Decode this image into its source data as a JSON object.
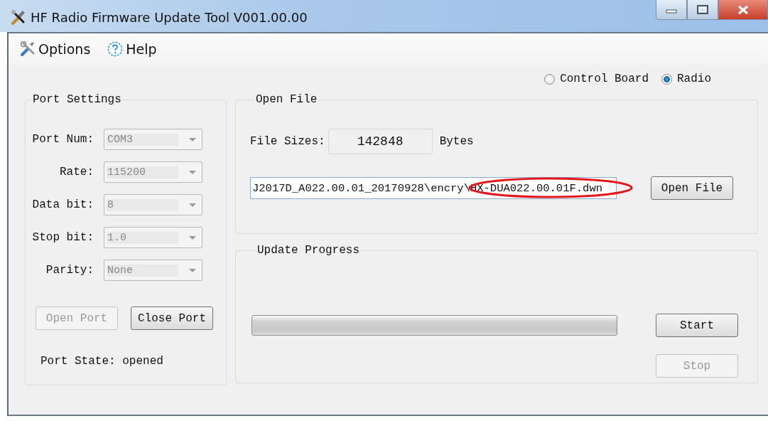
{
  "window": {
    "title": "HF Radio Firmware Update Tool V001.00.00"
  },
  "menu": [
    {
      "label": "Options",
      "kind": "tools"
    },
    {
      "label": "Help",
      "kind": "help"
    }
  ],
  "target": [
    {
      "label": "Control Board",
      "selected": false
    },
    {
      "label": "Radio",
      "selected": true
    }
  ],
  "port_settings": {
    "title": "Port Settings",
    "fields": [
      {
        "label": "Port Num:",
        "value": "COM3",
        "disabled": true
      },
      {
        "label": "Rate:",
        "value": "115200",
        "disabled": true
      },
      {
        "label": "Data bit:",
        "value": "8",
        "disabled": true
      },
      {
        "label": "Stop bit:",
        "value": "1.0",
        "disabled": true
      },
      {
        "label": "Parity:",
        "value": "None",
        "disabled": true
      }
    ],
    "buttons": [
      {
        "label": "Open Port",
        "disabled": true
      },
      {
        "label": "Close Port",
        "disabled": false
      }
    ],
    "state_text": "Port State: opened"
  },
  "open_file": {
    "title": "Open File",
    "size_label": "File Sizes:",
    "size_value": "142848",
    "size_unit": "Bytes",
    "path": "J2017D_A022.00.01_20170928\\encry\\HX-DUA022.00.01F.dwn",
    "path_highlighted": true,
    "button": "Open File"
  },
  "update_progress": {
    "title": "Update Progress",
    "level": 0,
    "buttons": [
      {
        "label": "Start",
        "disabled": false
      },
      {
        "label": "Stop",
        "disabled": true
      }
    ]
  }
}
